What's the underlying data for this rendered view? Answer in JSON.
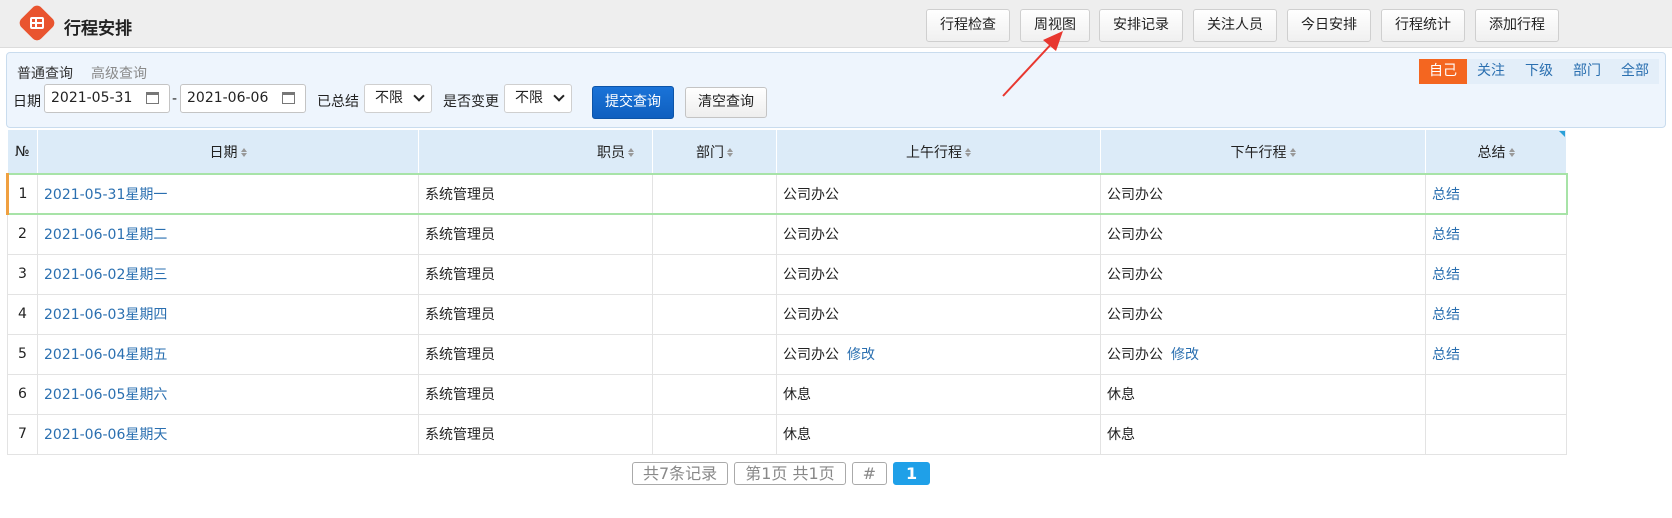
{
  "app": {
    "title": "行程安排",
    "logo_icon": "calendar-grid-icon",
    "accent": "#e9542f"
  },
  "toolbar": {
    "buttons": [
      "行程检查",
      "周视图",
      "安排记录",
      "关注人员",
      "今日安排",
      "行程统计",
      "添加行程"
    ]
  },
  "query": {
    "tabs": [
      "普通查询",
      "高级查询"
    ],
    "scope": [
      "自己",
      "关注",
      "下级",
      "部门",
      "全部"
    ],
    "scope_selected": "自己",
    "date_label": "日期",
    "date_from": "2021-05-31",
    "date_sep": "-",
    "date_to": "2021-06-06",
    "summarized_label": "已总结",
    "summarized_value": "不限",
    "changed_label": "是否变更",
    "changed_value": "不限",
    "submit": "提交查询",
    "clear": "清空查询"
  },
  "table": {
    "headers": [
      "№",
      "日期",
      "职员",
      "部门",
      "上午行程",
      "下午行程",
      "总结"
    ],
    "rows": [
      {
        "n": "1",
        "date": "2021-05-31星期一",
        "staff": "系统管理员",
        "dept": "",
        "am": "公司办公",
        "am_edit": "",
        "pm": "公司办公",
        "pm_edit": "",
        "summary": "总结"
      },
      {
        "n": "2",
        "date": "2021-06-01星期二",
        "staff": "系统管理员",
        "dept": "",
        "am": "公司办公",
        "am_edit": "",
        "pm": "公司办公",
        "pm_edit": "",
        "summary": "总结"
      },
      {
        "n": "3",
        "date": "2021-06-02星期三",
        "staff": "系统管理员",
        "dept": "",
        "am": "公司办公",
        "am_edit": "",
        "pm": "公司办公",
        "pm_edit": "",
        "summary": "总结"
      },
      {
        "n": "4",
        "date": "2021-06-03星期四",
        "staff": "系统管理员",
        "dept": "",
        "am": "公司办公",
        "am_edit": "",
        "pm": "公司办公",
        "pm_edit": "",
        "summary": "总结"
      },
      {
        "n": "5",
        "date": "2021-06-04星期五",
        "staff": "系统管理员",
        "dept": "",
        "am": "公司办公",
        "am_edit": "修改",
        "pm": "公司办公",
        "pm_edit": "修改",
        "summary": "总结"
      },
      {
        "n": "6",
        "date": "2021-06-05星期六",
        "staff": "系统管理员",
        "dept": "",
        "am": "休息",
        "am_edit": "",
        "pm": "休息",
        "pm_edit": "",
        "summary": ""
      },
      {
        "n": "7",
        "date": "2021-06-06星期天",
        "staff": "系统管理员",
        "dept": "",
        "am": "休息",
        "am_edit": "",
        "pm": "休息",
        "pm_edit": "",
        "summary": ""
      }
    ]
  },
  "pager": {
    "total": "共7条记录",
    "page_info": "第1页 共1页",
    "hash": "#",
    "current": "1"
  },
  "colors": {
    "link": "#2a6fb0",
    "scope_selected": "#f46620",
    "submit": "#1a73d8",
    "pager_current": "#1fa0e8",
    "annotation": "#e8372f"
  }
}
